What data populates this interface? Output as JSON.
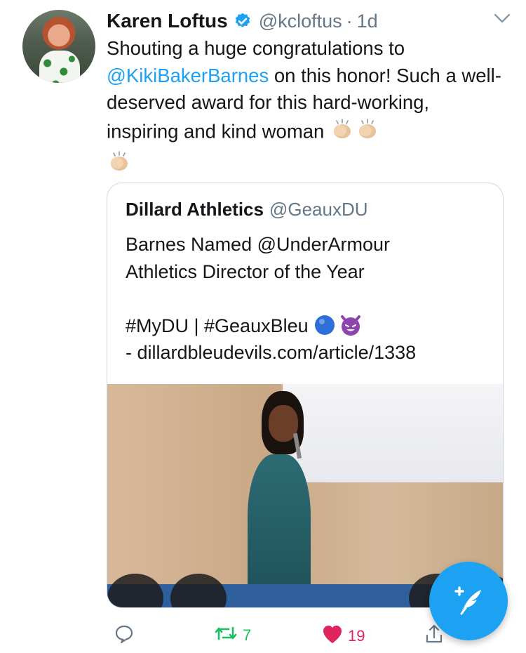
{
  "tweet": {
    "author_name": "Karen Loftus",
    "handle": "@kcloftus",
    "separator": "·",
    "time": "1d",
    "text_part1": "Shouting a huge congratulations to ",
    "mention": "@KikiBakerBarnes",
    "text_part2": " on this honor! Such a well-deserved award for this hard-working, inspiring and kind woman ",
    "emoji_count": 3
  },
  "quoted": {
    "name": "Dillard Athletics",
    "handle": "@GeauxDU",
    "body_line1": "Barnes Named @UnderArmour\nAthletics Director of the Year\n\n#MyDU | #GeauxBleu ",
    "body_line2": " - dillardbleudevils.com/article/1338"
  },
  "actions": {
    "retweet_count": "7",
    "like_count": "19"
  },
  "colors": {
    "accent": "#1da1f2",
    "retweet": "#17bf63",
    "like": "#e0245e",
    "muted": "#657786"
  },
  "icons": [
    "verified-badge-icon",
    "chevron-down-icon",
    "clapping-hands-icon",
    "blue-circle-icon",
    "smiling-devil-icon",
    "reply-icon",
    "retweet-icon",
    "heart-icon",
    "share-icon",
    "compose-tweet-icon"
  ]
}
